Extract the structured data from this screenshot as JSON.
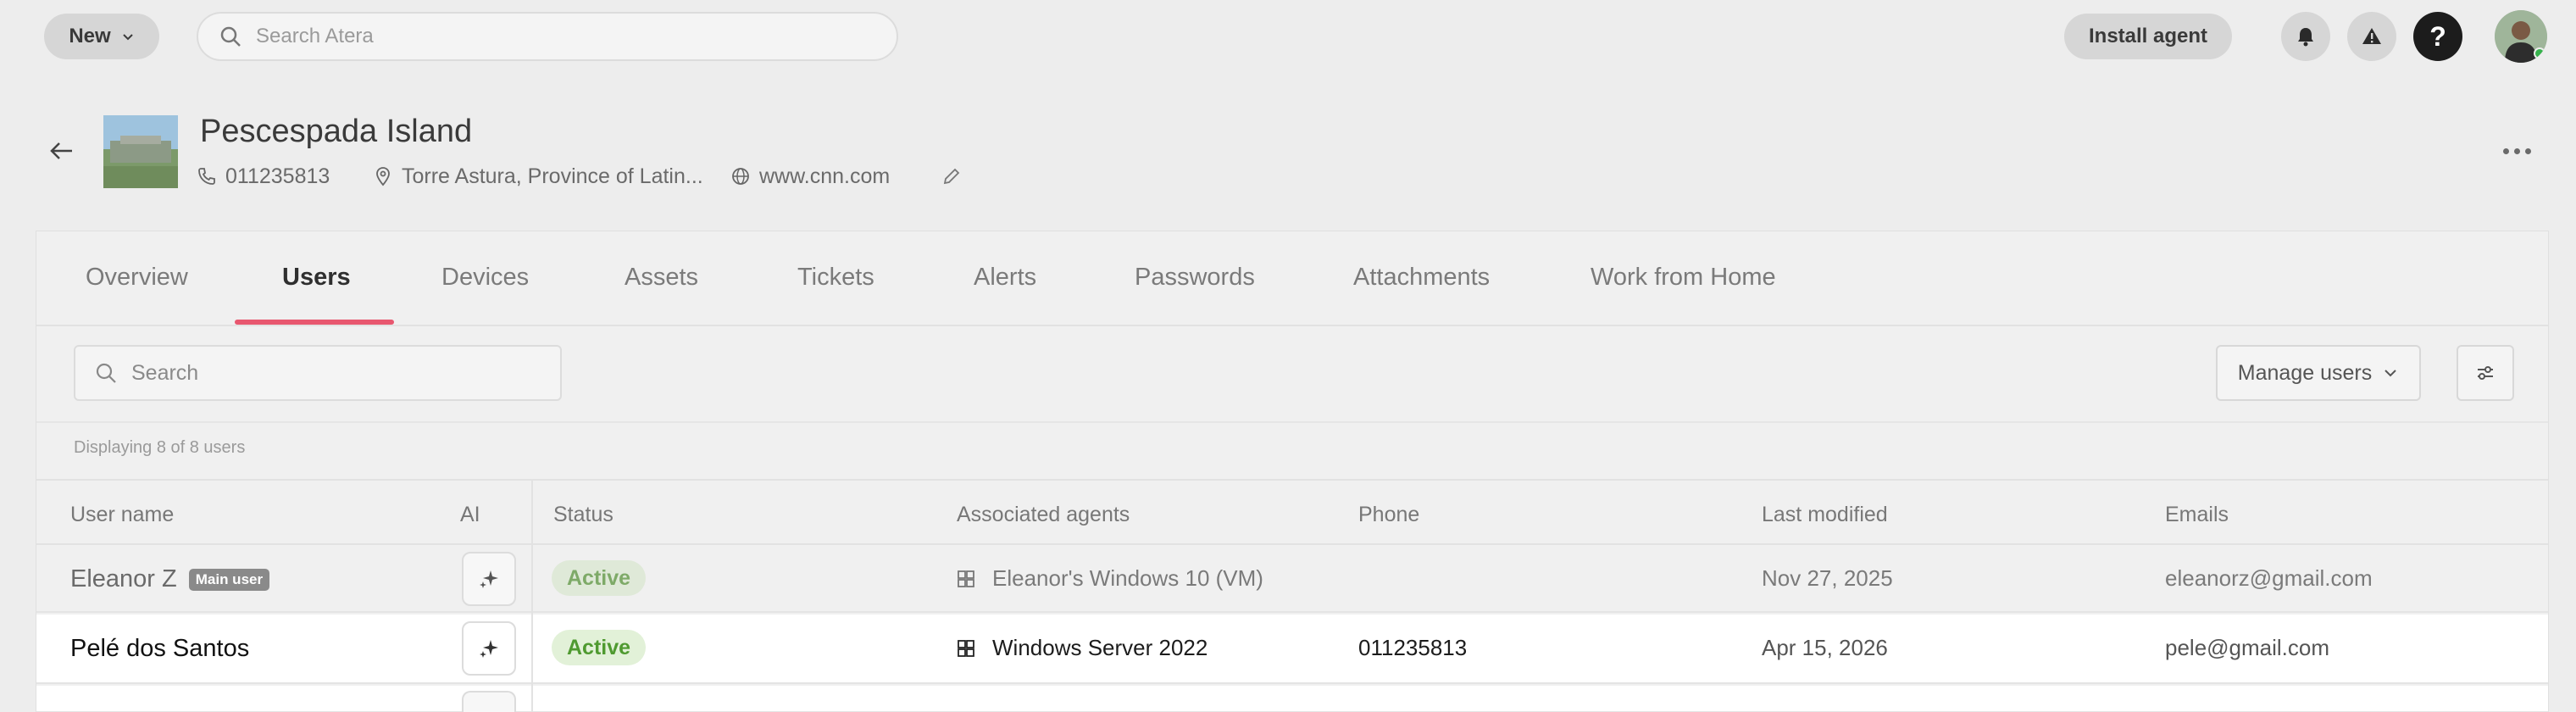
{
  "topbar": {
    "new_label": "New",
    "search_placeholder": "Search Atera",
    "install_label": "Install agent",
    "help_label": "?"
  },
  "header": {
    "title": "Pescespada Island",
    "phone": "011235813",
    "address": "Torre Astura, Province of Latin...",
    "website": "www.cnn.com"
  },
  "tabs": [
    {
      "label": "Overview"
    },
    {
      "label": "Users"
    },
    {
      "label": "Devices"
    },
    {
      "label": "Assets"
    },
    {
      "label": "Tickets"
    },
    {
      "label": "Alerts"
    },
    {
      "label": "Passwords"
    },
    {
      "label": "Attachments"
    },
    {
      "label": "Work from Home"
    }
  ],
  "active_tab": "Users",
  "toolbar": {
    "search_placeholder": "Search",
    "manage_label": "Manage users"
  },
  "count_text": "Displaying 8 of 8 users",
  "columns": [
    "User name",
    "AI",
    "Status",
    "Associated agents",
    "Phone",
    "Last modified",
    "Emails"
  ],
  "rows": [
    {
      "name": "Eleanor Z",
      "badge": "Main user",
      "status": "Active",
      "agent": "Eleanor's Windows 10 (VM)",
      "phone": "",
      "modified": "Nov 27, 2025",
      "email": "eleanorz@gmail.com"
    },
    {
      "name": "Pelé dos Santos",
      "badge": "",
      "status": "Active",
      "agent": "Windows Server 2022",
      "phone": "011235813",
      "modified": "Apr 15, 2026",
      "email": "pele@gmail.com"
    }
  ],
  "colors": {
    "accent_underline": "#e8576f",
    "status_active_bg": "#e2f1d8",
    "status_active_text": "#4f9a30"
  }
}
